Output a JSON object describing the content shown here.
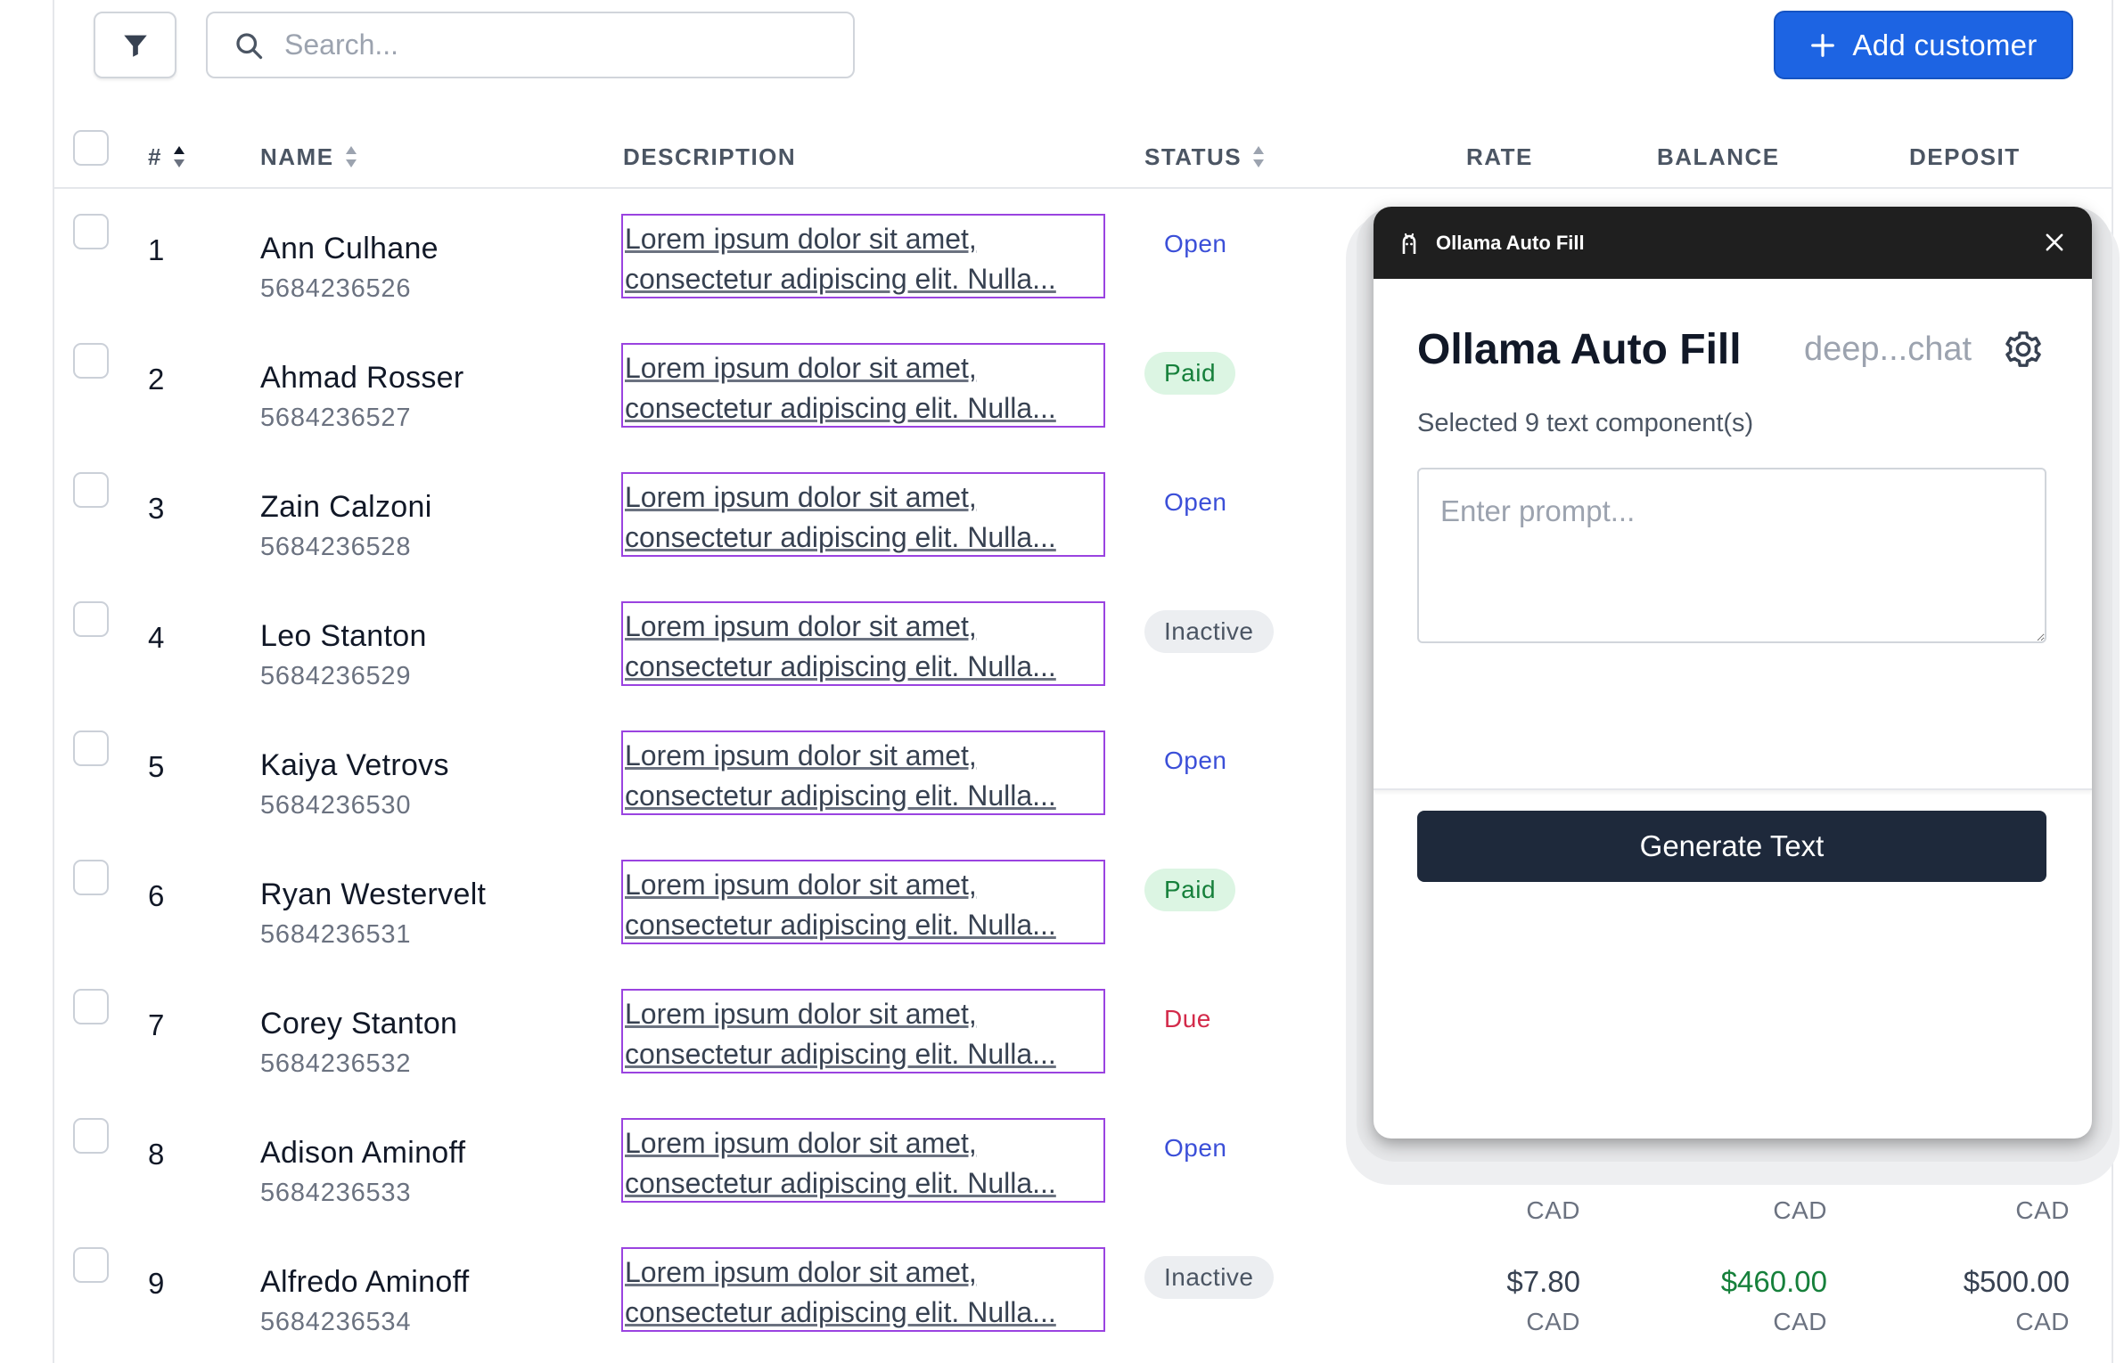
{
  "toolbar": {
    "search_placeholder": "Search...",
    "add_customer_label": "Add customer"
  },
  "table": {
    "headers": {
      "index": "#",
      "name": "NAME",
      "description": "DESCRIPTION",
      "status": "STATUS",
      "rate": "RATE",
      "balance": "BALANCE",
      "deposit": "DEPOSIT"
    },
    "rows": [
      {
        "index": "1",
        "name": "Ann Culhane",
        "phone": "5684236526",
        "desc1": "Lorem ipsum dolor sit amet,",
        "desc2": "consectetur adipiscing elit. Nulla...",
        "status": "Open",
        "status_kind": "open"
      },
      {
        "index": "2",
        "name": "Ahmad Rosser",
        "phone": "5684236527",
        "desc1": "Lorem ipsum dolor sit amet,",
        "desc2": "consectetur adipiscing elit. Nulla...",
        "status": "Paid",
        "status_kind": "paid"
      },
      {
        "index": "3",
        "name": "Zain Calzoni",
        "phone": "5684236528",
        "desc1": "Lorem ipsum dolor sit amet,",
        "desc2": "consectetur adipiscing elit. Nulla...",
        "status": "Open",
        "status_kind": "open"
      },
      {
        "index": "4",
        "name": "Leo Stanton",
        "phone": "5684236529",
        "desc1": "Lorem ipsum dolor sit amet,",
        "desc2": "consectetur adipiscing elit. Nulla...",
        "status": "Inactive",
        "status_kind": "inactive"
      },
      {
        "index": "5",
        "name": "Kaiya Vetrovs",
        "phone": "5684236530",
        "desc1": "Lorem ipsum dolor sit amet,",
        "desc2": "consectetur adipiscing elit. Nulla...",
        "status": "Open",
        "status_kind": "open"
      },
      {
        "index": "6",
        "name": "Ryan Westervelt",
        "phone": "5684236531",
        "desc1": "Lorem ipsum dolor sit amet,",
        "desc2": "consectetur adipiscing elit. Nulla...",
        "status": "Paid",
        "status_kind": "paid"
      },
      {
        "index": "7",
        "name": "Corey Stanton",
        "phone": "5684236532",
        "desc1": "Lorem ipsum dolor sit amet,",
        "desc2": "consectetur adipiscing elit. Nulla...",
        "status": "Due",
        "status_kind": "due"
      },
      {
        "index": "8",
        "name": "Adison Aminoff",
        "phone": "5684236533",
        "desc1": "Lorem ipsum dolor sit amet,",
        "desc2": "consectetur adipiscing elit. Nulla...",
        "status": "Open",
        "status_kind": "open",
        "rate_cur": "CAD",
        "balance_cur": "CAD",
        "deposit_cur": "CAD"
      },
      {
        "index": "9",
        "name": "Alfredo Aminoff",
        "phone": "5684236534",
        "desc1": "Lorem ipsum dolor sit amet,",
        "desc2": "consectetur adipiscing elit. Nulla...",
        "status": "Inactive",
        "status_kind": "inactive",
        "rate": "$7.80",
        "rate_cur": "CAD",
        "balance": "$460.00",
        "balance_cur": "CAD",
        "deposit": "$500.00",
        "deposit_cur": "CAD"
      }
    ]
  },
  "modal": {
    "bar_title": "Ollama Auto Fill",
    "heading": "Ollama Auto Fill",
    "model": "deep...chat",
    "subtitle": "Selected 9 text component(s)",
    "prompt_placeholder": "Enter prompt...",
    "generate_label": "Generate Text"
  },
  "colors": {
    "primary": "#1d64e3",
    "selection_outline": "#9a43e0",
    "paid": "#16803b",
    "due": "#d32a4a",
    "open": "#3b4fd8",
    "modal_bar": "#1f1f1f",
    "generate_button": "#1e293b"
  }
}
